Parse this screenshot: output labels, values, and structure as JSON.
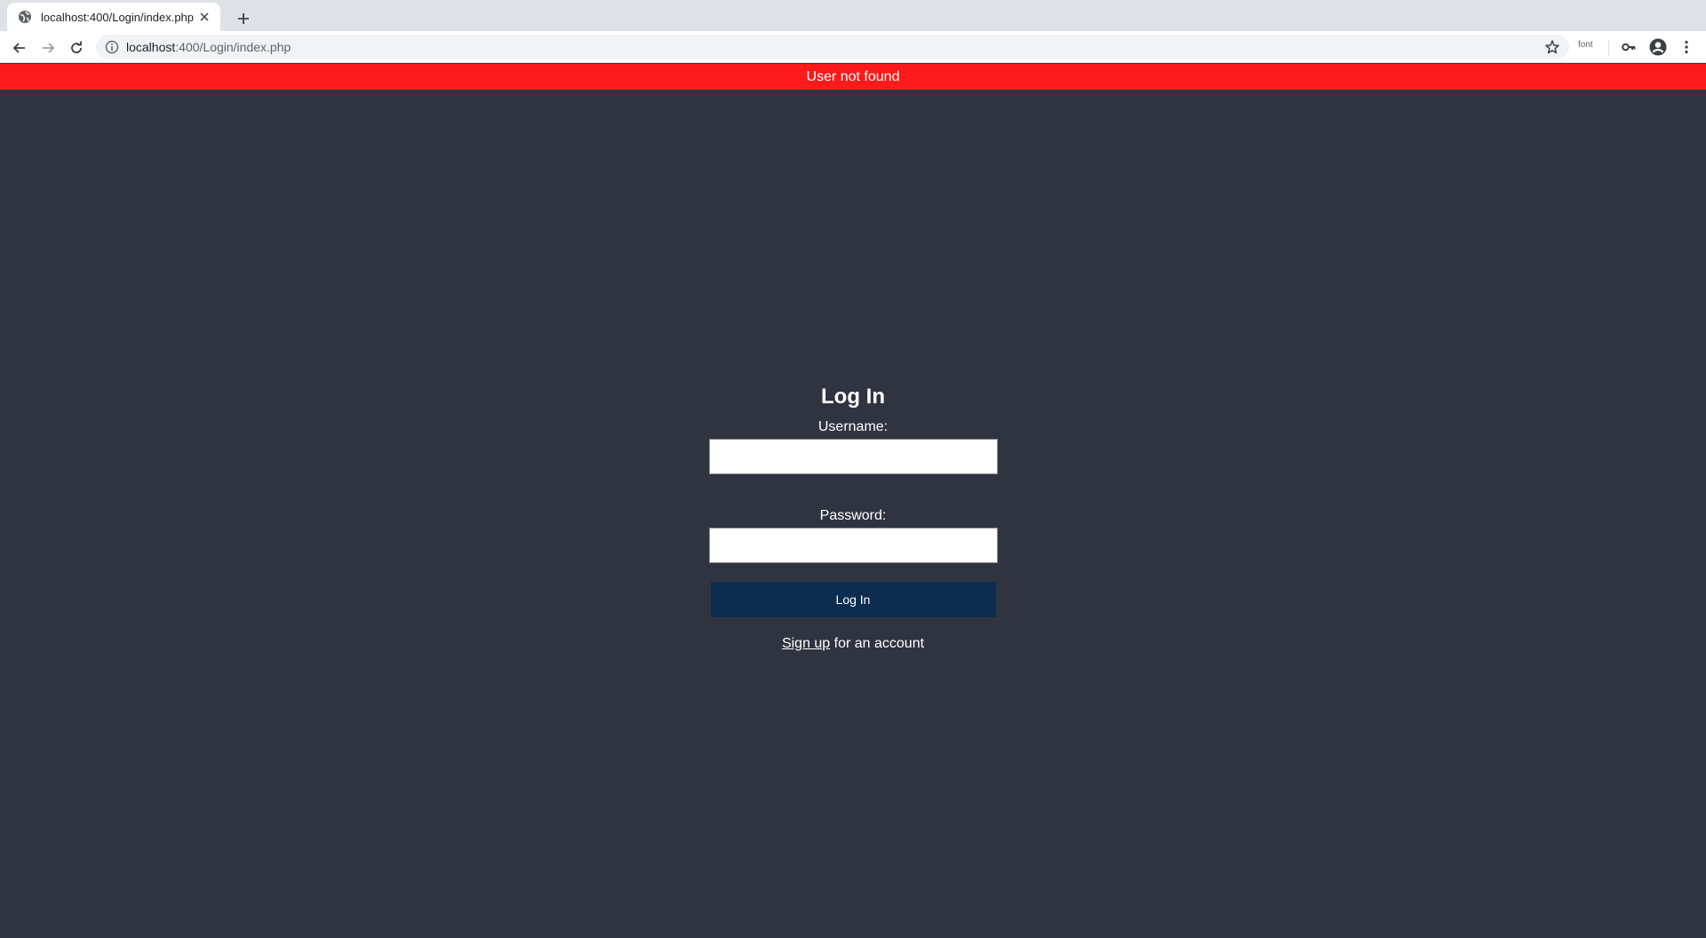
{
  "browser": {
    "tab_title": "localhost:400/Login/index.php",
    "url_host": "localhost",
    "url_rest": ":400/Login/index.php",
    "extension_label": "font",
    "icons": {
      "tab": "globe-icon",
      "close": "close-icon",
      "new_tab": "plus-icon",
      "back": "back-arrow-icon",
      "forward": "forward-arrow-icon",
      "reload": "reload-icon",
      "site_info": "info-icon",
      "bookmark": "star-icon",
      "passwords": "key-icon",
      "profile": "account-icon",
      "menu": "kebab-menu-icon"
    }
  },
  "alert": {
    "message": "User not found",
    "color": "#fc1a1a"
  },
  "login": {
    "title": "Log In",
    "username_label": "Username:",
    "username_value": "",
    "password_label": "Password:",
    "password_value": "",
    "submit_label": "Log In",
    "signup_link": "Sign up",
    "signup_suffix": " for an account"
  },
  "colors": {
    "page_background": "#2f3440",
    "button_background": "#0c2d50"
  }
}
